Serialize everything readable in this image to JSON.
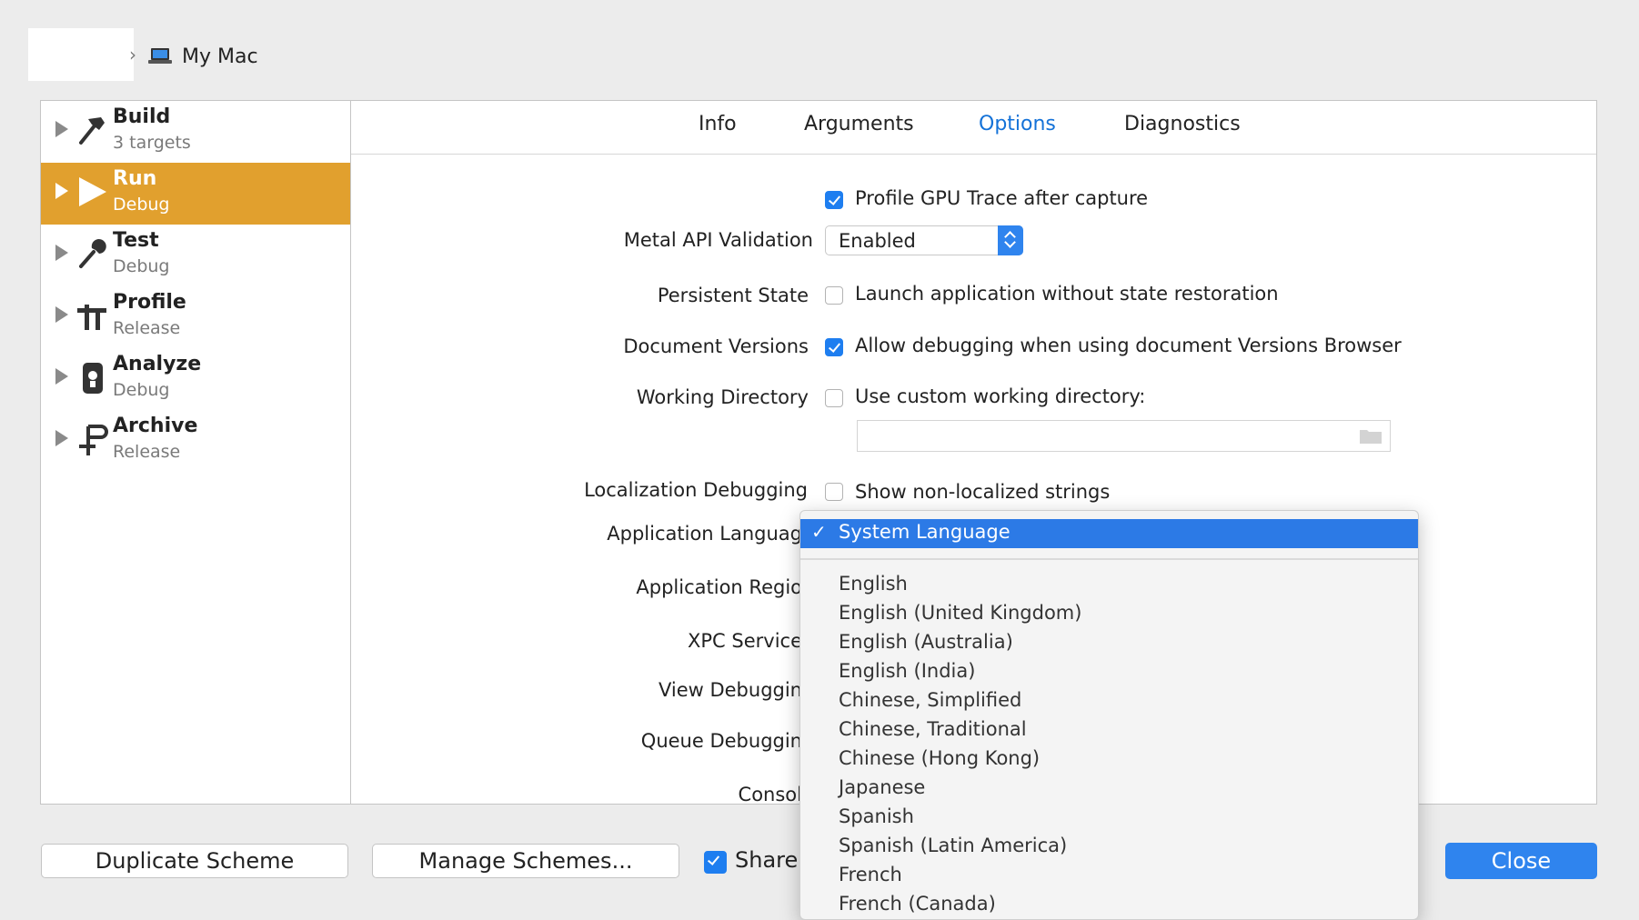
{
  "header": {
    "destination": "My Mac"
  },
  "sidebar": {
    "items": [
      {
        "title": "Build",
        "subtitle": "3 targets",
        "icon": "hammer-icon"
      },
      {
        "title": "Run",
        "subtitle": "Debug",
        "icon": "play-icon"
      },
      {
        "title": "Test",
        "subtitle": "Debug",
        "icon": "wrench-icon"
      },
      {
        "title": "Profile",
        "subtitle": "Release",
        "icon": "instruments-icon"
      },
      {
        "title": "Analyze",
        "subtitle": "Debug",
        "icon": "analyze-icon"
      },
      {
        "title": "Archive",
        "subtitle": "Release",
        "icon": "archive-icon"
      }
    ],
    "selected_index": 1
  },
  "tabs": {
    "items": [
      "Info",
      "Arguments",
      "Options",
      "Diagnostics"
    ],
    "active": "Options"
  },
  "options": {
    "gpu_trace_label": "Profile GPU Trace after capture",
    "gpu_trace_checked": true,
    "metal_label": "Metal API Validation",
    "metal_value": "Enabled",
    "persistent_label": "Persistent State",
    "persistent_cb_label": "Launch application without state restoration",
    "persistent_checked": false,
    "docversions_label": "Document Versions",
    "docversions_cb_label": "Allow debugging when using document Versions Browser",
    "docversions_checked": true,
    "workdir_label": "Working Directory",
    "workdir_cb_label": "Use custom working directory:",
    "workdir_checked": false,
    "workdir_value": "",
    "locdebug_label": "Localization Debugging",
    "locdebug_cb_label": "Show non-localized strings",
    "locdebug_checked": false,
    "applang_label": "Application Languag",
    "appregion_label": "Application Regio",
    "xpc_label": "XPC Service",
    "viewdebug_label": "View Debuggin",
    "queuedebug_label": "Queue Debuggin",
    "console_label": "Consol"
  },
  "language_dropdown": {
    "selected": "System Language",
    "check": "✓",
    "items": [
      "English",
      "English (United Kingdom)",
      "English (Australia)",
      "English (India)",
      "Chinese, Simplified",
      "Chinese, Traditional",
      "Chinese (Hong Kong)",
      "Japanese",
      "Spanish",
      "Spanish (Latin America)",
      "French",
      "French (Canada)"
    ]
  },
  "footer": {
    "duplicate_label": "Duplicate Scheme",
    "manage_label": "Manage Schemes...",
    "shared_label": "Share",
    "shared_checked": true,
    "close_label": "Close"
  },
  "colors": {
    "selected_sidebar": "#e1a02e",
    "accent_blue": "#2f84ee",
    "active_tab": "#1472d8"
  }
}
